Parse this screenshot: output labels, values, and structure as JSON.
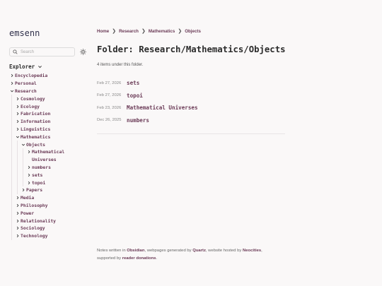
{
  "site": {
    "title": "emsenn"
  },
  "search": {
    "placeholder": "Search"
  },
  "explorer": {
    "label": "Explorer",
    "tree": {
      "top": [
        "Encyclopedia",
        "Personal"
      ],
      "research": "Research",
      "research_children_before": [
        "Cosmology",
        "Ecology",
        "Fabrication",
        "Information",
        "Linguistics"
      ],
      "mathematics": "Mathematics",
      "objects": "Objects",
      "objects_children": [
        "Mathematical Universes",
        "numbers",
        "sets",
        "topoi"
      ],
      "papers": "Papers",
      "research_children_after": [
        "Media",
        "Philosophy",
        "Power",
        "Relationality",
        "Sociology",
        "Technology"
      ]
    }
  },
  "breadcrumb": [
    "Home",
    "Research",
    "Mathematics",
    "Objects"
  ],
  "page": {
    "title": "Folder: Research/Mathematics/Objects",
    "count": "4 items under this folder."
  },
  "entries": [
    {
      "date": "Feb 27, 2026",
      "name": "sets"
    },
    {
      "date": "Feb 27, 2026",
      "name": "topoi"
    },
    {
      "date": "Feb 23, 2026",
      "name": "Mathematical Universes"
    },
    {
      "date": "Dec 26, 2025",
      "name": "numbers"
    }
  ],
  "footer": {
    "t1": "Notes written in ",
    "obsidian": "Obsidian",
    "t2": ", webpages generated by ",
    "quartz": "Quartz",
    "t3": ", website hosted by ",
    "neocities": "Neocities",
    "t4": ",",
    "t5": "supported by ",
    "donations": "reader donations",
    "t6": "."
  },
  "colors": {
    "accent": "#6b3b57",
    "text": "#2b2b2b",
    "muted": "#888888",
    "background": "#faf8f8"
  }
}
